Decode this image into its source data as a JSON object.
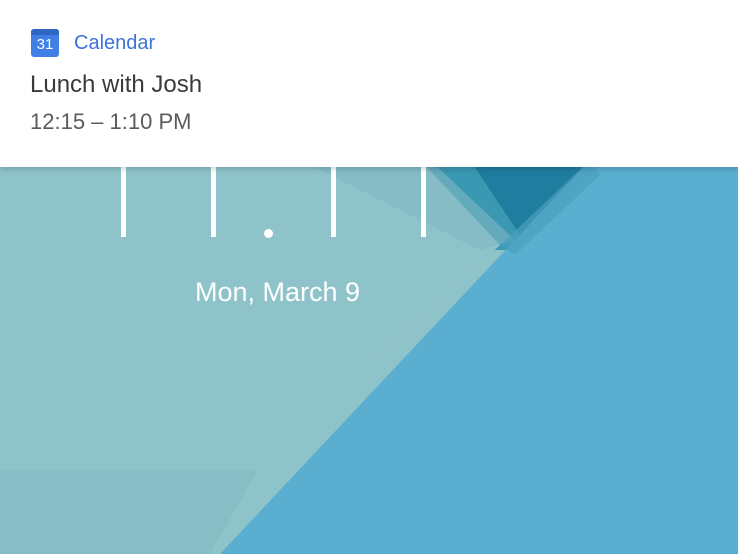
{
  "notification": {
    "app_icon_day": "31",
    "app_name": "Calendar",
    "title": "Lunch with Josh",
    "time": "12:15 – 1:10 PM",
    "accent_color": "#3d73d6"
  },
  "lockscreen": {
    "date": "Mon, March 9",
    "clock_separator_icon": "dot-icon"
  },
  "colors": {
    "wallpaper_light": "#8fc3ca",
    "wallpaper_blue": "#5aaed0",
    "wallpaper_dark": "#2c8eb0"
  }
}
